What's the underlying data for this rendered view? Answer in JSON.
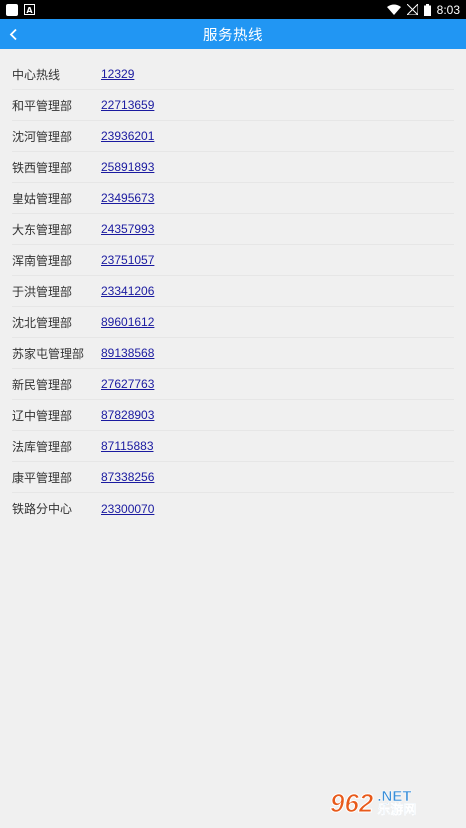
{
  "status_bar": {
    "time": "8:03"
  },
  "header": {
    "title": "服务热线",
    "back_icon": "chevron-left-icon"
  },
  "hotlines": [
    {
      "name": "中心热线",
      "phone": "12329"
    },
    {
      "name": "和平管理部",
      "phone": "22713659"
    },
    {
      "name": "沈河管理部",
      "phone": "23936201"
    },
    {
      "name": "铁西管理部",
      "phone": "25891893"
    },
    {
      "name": "皇姑管理部",
      "phone": "23495673"
    },
    {
      "name": "大东管理部",
      "phone": "24357993"
    },
    {
      "name": "浑南管理部",
      "phone": "23751057"
    },
    {
      "name": "于洪管理部",
      "phone": "23341206"
    },
    {
      "name": "沈北管理部",
      "phone": "89601612"
    },
    {
      "name": "苏家屯管理部",
      "phone": "89138568"
    },
    {
      "name": "新民管理部",
      "phone": "27627763"
    },
    {
      "name": "辽中管理部",
      "phone": "87828903"
    },
    {
      "name": "法库管理部",
      "phone": "87115883"
    },
    {
      "name": "康平管理部",
      "phone": "87338256"
    },
    {
      "name": "铁路分中心",
      "phone": "23300070"
    }
  ],
  "watermark": {
    "number": "962",
    "net": ".NET",
    "cn": "乐游网"
  },
  "colors": {
    "title_bar": "#2196f3",
    "link": "#1a1aa0",
    "background": "#f0f0f0"
  }
}
